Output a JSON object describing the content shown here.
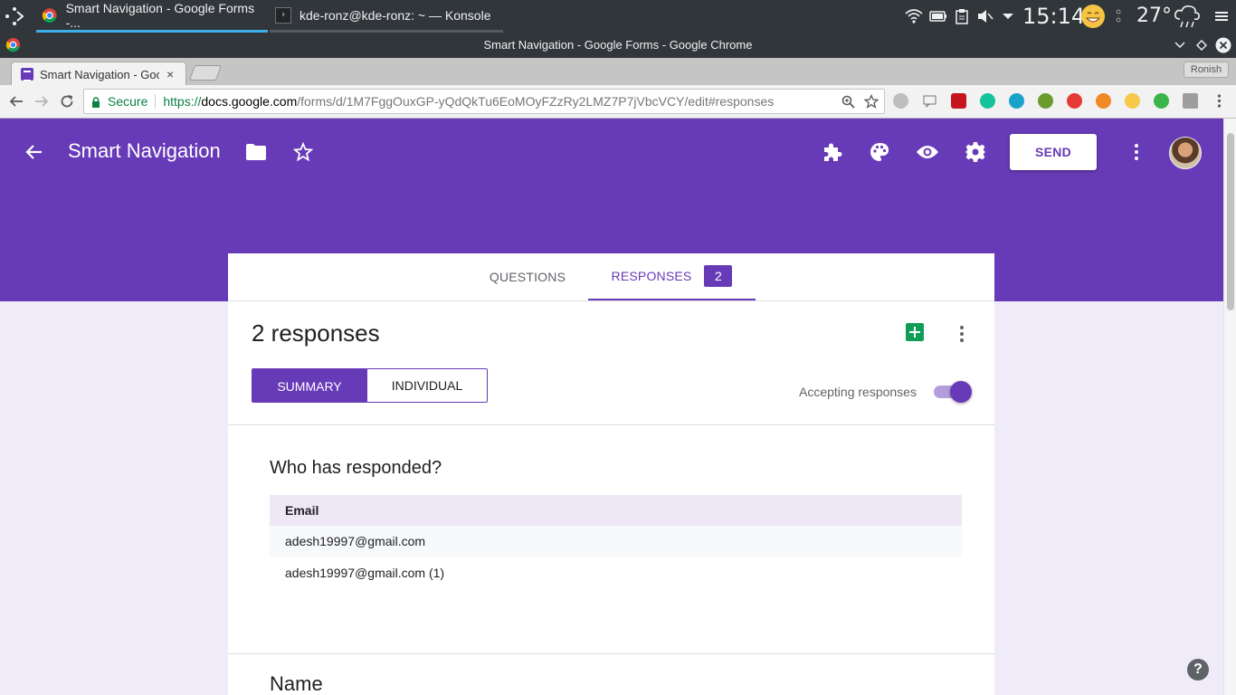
{
  "taskbar": {
    "tasks": [
      {
        "label": "Smart Navigation - Google Forms -..."
      },
      {
        "label": "kde-ronz@kde-ronz: ~ — Konsole"
      }
    ],
    "clock": "15:14",
    "temperature": "27°"
  },
  "window": {
    "title": "Smart Navigation - Google Forms - Google Chrome"
  },
  "browser": {
    "active_tab_label": "Smart Navigation - Google Forms",
    "tab_close": "×",
    "profile_name": "Ronish",
    "secure_label": "Secure",
    "url_scheme": "https://",
    "url_host": "docs.google.com",
    "url_path": "/forms/d/1M7FggOuxGP-yQdQkTu6EoMOyFZzRy2LMZ7P7jVbcVCY/edit#responses"
  },
  "app": {
    "form_title": "Smart Navigation",
    "send_label": "SEND",
    "accent": "#673ab7"
  },
  "form_tabs": {
    "questions_label": "QUESTIONS",
    "responses_label": "RESPONSES",
    "responses_count": "2"
  },
  "summary": {
    "count_title": "2 responses",
    "summary_label": "SUMMARY",
    "individual_label": "INDIVIDUAL",
    "accepting_label": "Accepting responses",
    "accepting_on": true
  },
  "respondents": {
    "title": "Who has responded?",
    "column_header": "Email",
    "rows": [
      "adesh19997@gmail.com",
      "adesh19997@gmail.com (1)"
    ]
  },
  "next_section": {
    "title": "Name"
  },
  "help": "?"
}
